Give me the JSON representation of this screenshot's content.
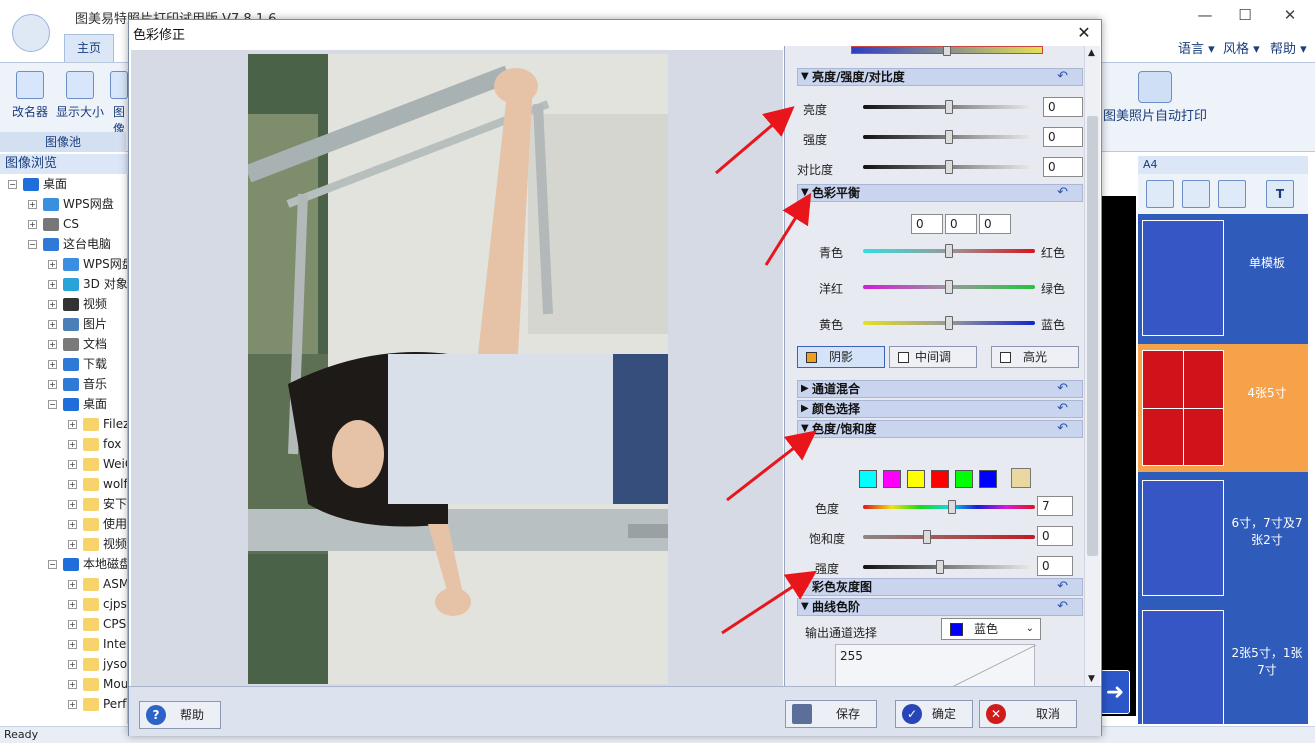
{
  "app": {
    "title": "图美易特照片打印试用版 V7.8.1.6",
    "tab_home": "主页",
    "menu_language": "语言",
    "menu_style": "风格",
    "menu_help": "帮助",
    "ribbon_buttons": [
      "改名器",
      "显示大小",
      "图像"
    ],
    "group_label": "图像池",
    "auto_print": "图美照片自动打印"
  },
  "tree": {
    "header": "图像浏览",
    "items": [
      {
        "label": "桌面",
        "indent": 0
      },
      {
        "label": "WPS网盘",
        "indent": 1
      },
      {
        "label": "CS",
        "indent": 1
      },
      {
        "label": "这台电脑",
        "indent": 1
      },
      {
        "label": "WPS网盘",
        "indent": 2
      },
      {
        "label": "3D 对象",
        "indent": 2
      },
      {
        "label": "视频",
        "indent": 2
      },
      {
        "label": "图片",
        "indent": 2
      },
      {
        "label": "文档",
        "indent": 2
      },
      {
        "label": "下载",
        "indent": 2
      },
      {
        "label": "音乐",
        "indent": 2
      },
      {
        "label": "桌面",
        "indent": 2
      },
      {
        "label": "Filez",
        "indent": 3
      },
      {
        "label": "fox",
        "indent": 3
      },
      {
        "label": "WeiC",
        "indent": 3
      },
      {
        "label": "wolf",
        "indent": 3
      },
      {
        "label": "安下载",
        "indent": 3
      },
      {
        "label": "使用",
        "indent": 3
      },
      {
        "label": "视频",
        "indent": 3
      },
      {
        "label": "本地磁盘",
        "indent": 2
      },
      {
        "label": "ASM",
        "indent": 3
      },
      {
        "label": "cjps",
        "indent": 3
      },
      {
        "label": "CPS",
        "indent": 3
      },
      {
        "label": "Intel",
        "indent": 3
      },
      {
        "label": "jysof",
        "indent": 3
      },
      {
        "label": "Mou",
        "indent": 3
      },
      {
        "label": "Perfl",
        "indent": 3
      }
    ]
  },
  "status": {
    "text": "Ready"
  },
  "templates": {
    "header": "A4",
    "items": [
      {
        "label": "单模板"
      },
      {
        "label": "4张5寸"
      },
      {
        "label": "6寸，7寸及7张2寸"
      },
      {
        "label": "2张5寸，1张7寸"
      }
    ]
  },
  "dialog": {
    "title": "色彩修正",
    "sections": {
      "brightness": "亮度/强度/对比度",
      "color_balance": "色彩平衡",
      "channel_mix": "通道混合",
      "color_select": "颜色选择",
      "hue_saturation": "色度/饱和度",
      "color_gray": "彩色灰度图",
      "curves": "曲线色阶"
    },
    "brightness": {
      "labels": [
        "亮度",
        "强度",
        "对比度"
      ],
      "values": [
        "0",
        "0",
        "0"
      ],
      "levels": [
        0.5,
        0.5,
        0.5
      ]
    },
    "balance": {
      "triplet": [
        "0",
        "0",
        "0"
      ],
      "left_labels": [
        "青色",
        "洋红",
        "黄色"
      ],
      "right_labels": [
        "红色",
        "绿色",
        "蓝色"
      ],
      "levels": [
        0.5,
        0.5,
        0.5
      ],
      "tones": [
        "阴影",
        "中间调",
        "高光"
      ],
      "selected_tone": "阴影"
    },
    "hue": {
      "labels": [
        "色度",
        "饱和度",
        "强度"
      ],
      "values": [
        "7",
        "0",
        "0"
      ],
      "levels": [
        0.52,
        0.37,
        0.45
      ],
      "swatches": [
        "#00ffff",
        "#ff00ff",
        "#ffff00",
        "#ff0000",
        "#00ff00",
        "#0000ff"
      ]
    },
    "curves": {
      "channel_label": "输出通道选择",
      "channel_value": "蓝色",
      "channel_color": "#0000ff",
      "max_value": "255"
    },
    "buttons": {
      "help": "帮助",
      "save": "保存",
      "ok": "确定",
      "cancel": "取消"
    }
  },
  "colors": {
    "accent": "#2f5bbb",
    "template_selected": "#f5a24b",
    "template_red": "#d0121b",
    "arrow": "#e8161b"
  }
}
